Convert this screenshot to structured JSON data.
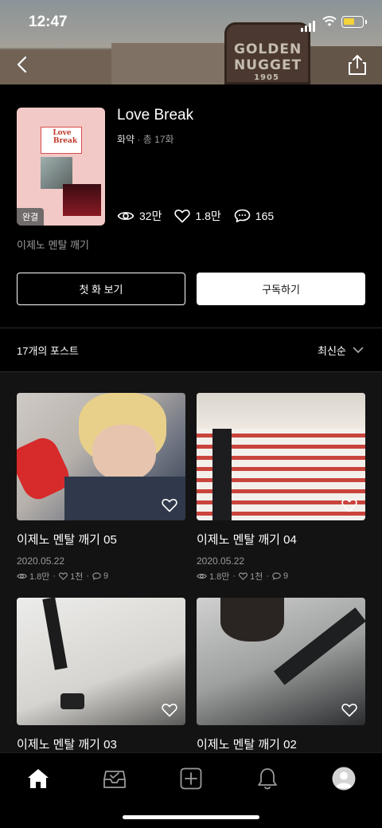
{
  "status_bar": {
    "time": "12:47"
  },
  "hero": {
    "sign_line1": "GOLDEN",
    "sign_line2": "NUGGET",
    "sign_line3": "1905"
  },
  "cover": {
    "art_title_line1": "Love",
    "art_title_line2": "Break",
    "badge": "완결"
  },
  "series": {
    "title": "Love Break",
    "genre": "화약",
    "dot": "·",
    "episodes": "총 17화",
    "views": "32만",
    "likes": "1.8만",
    "comments": "165",
    "author": "이제노 멘탈 깨기"
  },
  "buttons": {
    "first_episode": "첫 화 보기",
    "subscribe": "구독하기"
  },
  "list_header": {
    "count": "17개의 포스트",
    "sort": "최신순"
  },
  "posts": [
    {
      "title": "이제노 멘탈 깨기 05",
      "date": "2020.05.22",
      "views": "1.8만",
      "likes": "1천",
      "comments": "9"
    },
    {
      "title": "이제노 멘탈 깨기 04",
      "date": "2020.05.22",
      "views": "1.8만",
      "likes": "1천",
      "comments": "9"
    },
    {
      "title": "이제노 멘탈 깨기 03"
    },
    {
      "title": "이제노 멘탈 깨기 02"
    }
  ],
  "icons": {
    "back": "chevron-left-icon",
    "share": "share-icon",
    "eye": "eye-icon",
    "heart": "heart-icon",
    "comment": "comment-icon",
    "sort": "chevron-down-icon",
    "home": "home-icon",
    "inbox": "inbox-icon",
    "create": "plus-square-icon",
    "notifications": "bell-icon",
    "profile": "avatar-icon"
  },
  "colors": {
    "background": "#000000",
    "list_background": "#131313",
    "badge_battery": "#f5d33c"
  }
}
